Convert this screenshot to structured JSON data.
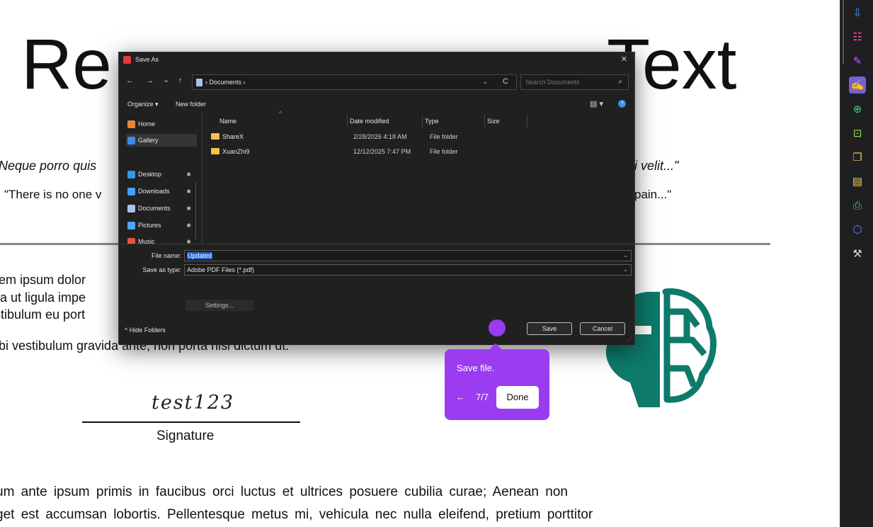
{
  "document": {
    "title_left": "Re",
    "title_right": "Text",
    "quote_italic_left": "Neque porro quis",
    "quote_italic_right": "i velit...\"",
    "quote_normal_left": "\"There is no one v",
    "quote_normal_right": "pain...\"",
    "lorem_lines": [
      "rem ipsum dolor",
      "lla ut ligula impe",
      "stibulum eu port",
      "rbi vestibulum gravida ante, non porta nisi dictum ut."
    ],
    "signature_value": "test123",
    "signature_label": "Signature",
    "paragraph_lines": [
      "um ante ipsum primis in faucibus orci luctus et ultrices posuere cubilia curae; Aenean non",
      "get est accumsan lobortis. Pellentesque metus mi, vehicula nec nulla eleifend, pretium porttitor"
    ],
    "logo_color": "#0d7a6a"
  },
  "toolbar": {
    "icons": [
      {
        "name": "export-pdf-icon",
        "glyph": "⇩",
        "color": "#4aa3ff",
        "active": false
      },
      {
        "name": "organize-pages-icon",
        "glyph": "☷",
        "color": "#ff4fa8",
        "active": false
      },
      {
        "name": "request-signature-icon",
        "glyph": "✎",
        "color": "#c45bff",
        "active": false
      },
      {
        "name": "fill-and-sign-icon",
        "glyph": "✍",
        "color": "#ffffff",
        "active": true
      },
      {
        "name": "edit-pdf-icon",
        "glyph": "⊕",
        "color": "#3fd47a",
        "active": false
      },
      {
        "name": "scan-ocr-icon",
        "glyph": "⊡",
        "color": "#9be34a",
        "active": false
      },
      {
        "name": "combine-files-icon",
        "glyph": "❐",
        "color": "#f2c14e",
        "active": false
      },
      {
        "name": "comment-icon",
        "glyph": "▤",
        "color": "#f2d24e",
        "active": false
      },
      {
        "name": "print-production-icon",
        "glyph": "⎙",
        "color": "#3fd47a",
        "active": false
      },
      {
        "name": "protect-icon",
        "glyph": "⬡",
        "color": "#5b8cff",
        "active": false
      },
      {
        "name": "more-tools-icon",
        "glyph": "⚒",
        "color": "#d8d8d8",
        "active": false
      }
    ]
  },
  "dialog": {
    "title": "Save As",
    "close_glyph": "✕",
    "nav": {
      "back": "←",
      "forward": "→",
      "recent": "⌄",
      "up": "↑"
    },
    "address_path": "›  Documents  ›",
    "address_dropdown": "⌄",
    "refresh_glyph": "C",
    "search_placeholder": "Search Documents",
    "search_glyph": "⌕",
    "organize_label": "Organize ▾",
    "new_folder_label": "New folder",
    "view_glyph": "▤ ▾",
    "help_glyph": "?",
    "nav_pane": [
      {
        "label": "Home",
        "color": "#e8843a",
        "pinned": false,
        "selected": false
      },
      {
        "label": "Gallery",
        "color": "#3a8de8",
        "pinned": false,
        "selected": true
      },
      {
        "label": "Desktop",
        "color": "#2e9be8",
        "pinned": true,
        "selected": false
      },
      {
        "label": "Downloads",
        "color": "#3fa0ff",
        "pinned": true,
        "selected": false
      },
      {
        "label": "Documents",
        "color": "#a9c3e8",
        "pinned": true,
        "selected": false
      },
      {
        "label": "Pictures",
        "color": "#4aa3ff",
        "pinned": true,
        "selected": false
      },
      {
        "label": "Music",
        "color": "#e8553a",
        "pinned": true,
        "selected": false
      }
    ],
    "columns": {
      "name": "Name",
      "date": "Date modified",
      "type": "Type",
      "size": "Size"
    },
    "files": [
      {
        "name": "ShareX",
        "date": "2/28/2026 4:18 AM",
        "type": "File folder"
      },
      {
        "name": "XuanZhi9",
        "date": "12/12/2025 7:47 PM",
        "type": "File folder"
      }
    ],
    "file_name_label": "File name:",
    "file_name_value": "Updated",
    "save_type_label": "Save as type:",
    "save_type_value": "Adobe PDF Files (*.pdf)",
    "settings_label": "Settings...",
    "hide_folders_label": "Hide Folders",
    "save_label": "Save",
    "cancel_label": "Cancel"
  },
  "tour": {
    "message": "Save file.",
    "prev_glyph": "←",
    "step": "7/7",
    "done_label": "Done",
    "color": "#9b3cf0"
  }
}
